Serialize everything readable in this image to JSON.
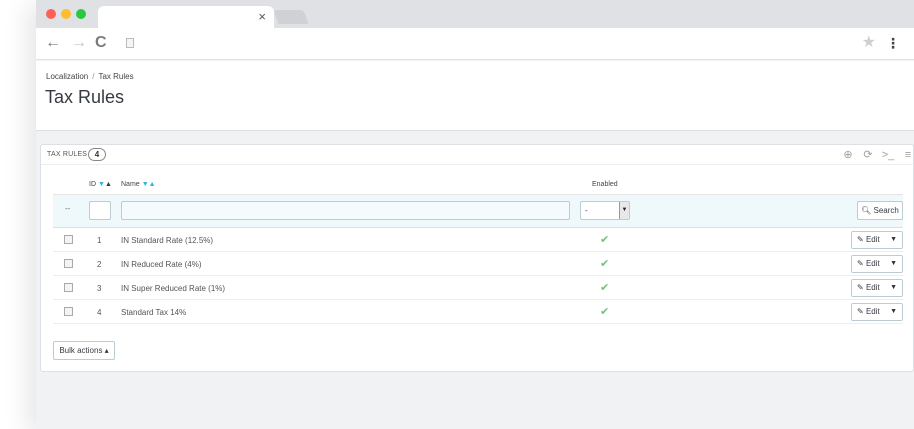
{
  "browser": {
    "tab_close": "×",
    "icons": {
      "back": "←",
      "forward": "→",
      "reload": "C",
      "star": "★",
      "menu": "⋮"
    }
  },
  "breadcrumb": {
    "parent": "Localization",
    "separator": "/",
    "current": "Tax Rules"
  },
  "page_title": "Tax Rules",
  "panel": {
    "title": "TAX RULES",
    "count": "4"
  },
  "table": {
    "headers": {
      "id": "ID",
      "name": "Name",
      "enabled": "Enabled"
    },
    "filter": {
      "dash": "--",
      "enabled_value": "-",
      "search_label": "Search"
    },
    "rows": [
      {
        "id": "1",
        "name": "IN Standard Rate (12.5%)",
        "enabled": "✔"
      },
      {
        "id": "2",
        "name": "IN Reduced Rate (4%)",
        "enabled": "✔"
      },
      {
        "id": "3",
        "name": "IN Super Reduced Rate (1%)",
        "enabled": "✔"
      },
      {
        "id": "4",
        "name": "Standard Tax 14%",
        "enabled": "✔"
      }
    ],
    "edit_label": "Edit"
  },
  "bulk_actions": "Bulk actions ▴",
  "colors": {
    "accent": "#25b9d7",
    "enabled_check": "#72c279"
  }
}
